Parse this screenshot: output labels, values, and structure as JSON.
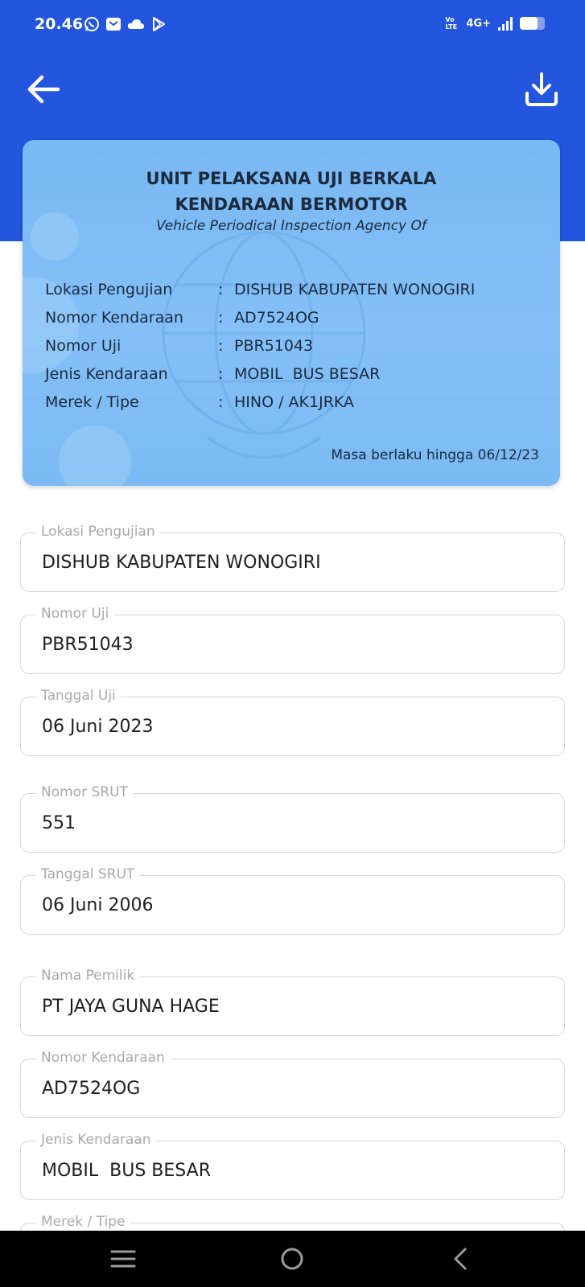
{
  "status_bar": {
    "time": "20.46",
    "network": "4G+",
    "lte": "Vo LTE",
    "battery_level": 0.7
  },
  "icons": {
    "back": "arrow-left-icon",
    "download": "download-icon"
  },
  "card": {
    "title_line1": "UNIT PELAKSANA UJI BERKALA",
    "title_line2": "KENDARAAN BERMOTOR",
    "subtitle": "Vehicle Periodical Inspection Agency Of",
    "rows": [
      {
        "label": "Lokasi Pengujian",
        "value": "DISHUB KABUPATEN WONOGIRI"
      },
      {
        "label": "Nomor Kendaraan",
        "value": "AD7524OG"
      },
      {
        "label": "Nomor Uji",
        "value": "PBR51043"
      },
      {
        "label": "Jenis Kendaraan",
        "value": "MOBIL  BUS BESAR"
      },
      {
        "label": "Merek / Tipe",
        "value": "HINO / AK1JRKA"
      }
    ],
    "colon": ":",
    "validity": "Masa berlaku hingga 06/12/23"
  },
  "fields": [
    {
      "label": "Lokasi Pengujian",
      "value": "DISHUB KABUPATEN WONOGIRI"
    },
    {
      "label": "Nomor Uji",
      "value": "PBR51043"
    },
    {
      "label": "Tanggal Uji",
      "value": "06 Juni 2023"
    },
    {
      "label": "Nomor SRUT",
      "value": "551"
    },
    {
      "label": "Tanggal SRUT",
      "value": "06 Juni 2006"
    },
    {
      "label": "Nama Pemilik",
      "value": "PT JAYA GUNA HAGE"
    },
    {
      "label": "Nomor Kendaraan",
      "value": "AD7524OG"
    },
    {
      "label": "Jenis Kendaraan",
      "value": "MOBIL  BUS BESAR"
    },
    {
      "label": "Merek / Tipe",
      "value": ""
    }
  ],
  "nav": {
    "recents": "menu-icon",
    "home": "home-circle-icon",
    "back": "chevron-left-icon"
  },
  "colors": {
    "header": "#2355de",
    "card": "#7ab8f3"
  }
}
